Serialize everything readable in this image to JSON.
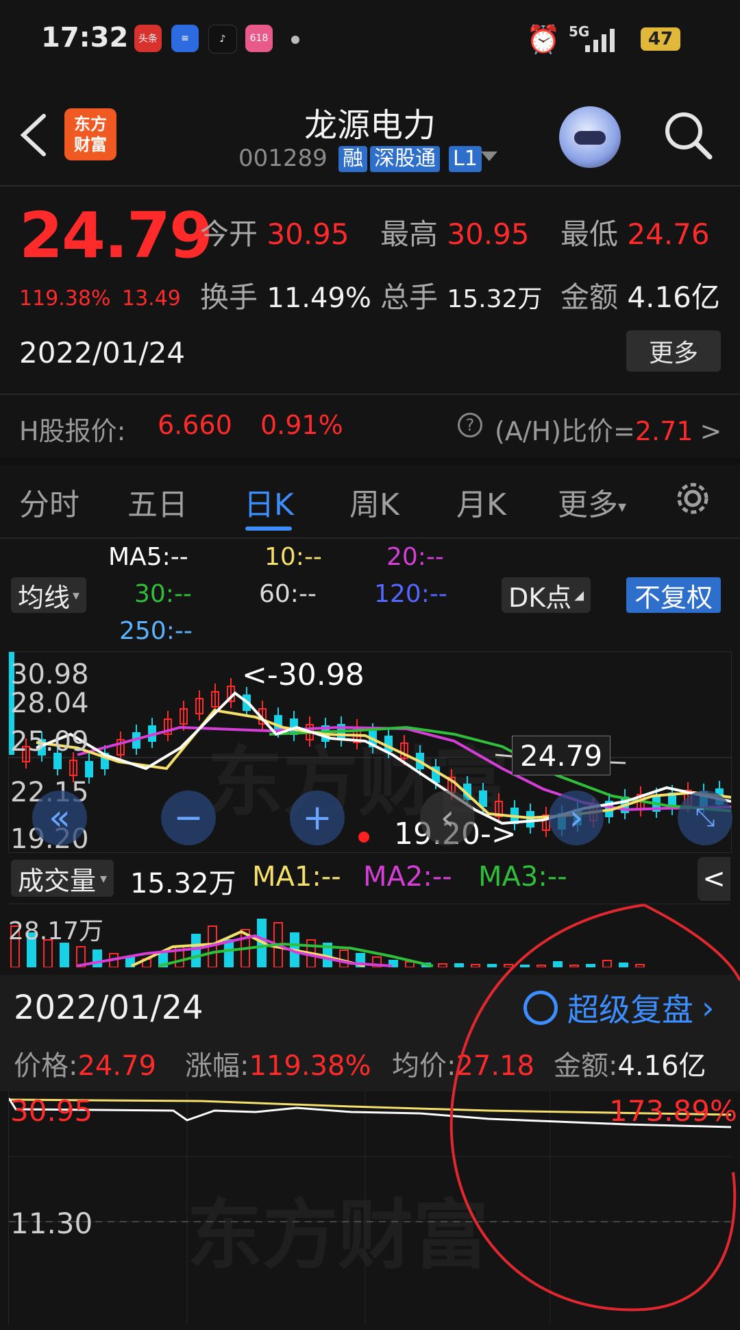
{
  "status_bar": {
    "time": "17:32",
    "battery": "47",
    "signal": "5G"
  },
  "header": {
    "logo_text": "东方财富",
    "title": "龙源电力",
    "code": "001289",
    "tags": [
      "融",
      "深股通",
      "L1"
    ]
  },
  "quote": {
    "price": "24.79",
    "change_pct": "119.38%",
    "change": "13.49",
    "date": "2022/01/24",
    "open_label": "今开",
    "open": "30.95",
    "high_label": "最高",
    "high": "30.95",
    "low_label": "最低",
    "low": "24.76",
    "turnover_label": "换手",
    "turnover": "11.49%",
    "volume_label": "总手",
    "volume": "15.32万",
    "amount_label": "金额",
    "amount": "4.16亿",
    "more_button": "更多"
  },
  "hshare": {
    "label": "H股报价:",
    "price": "6.660",
    "pct": "0.91%",
    "ratio_label": "(A/H)比价=",
    "ratio": "2.71",
    "arrow": ">"
  },
  "tabs": [
    "分时",
    "五日",
    "日K",
    "周K",
    "月K",
    "更多"
  ],
  "active_tab": "日K",
  "ma_legend": {
    "ma5": "MA5:--",
    "ma10": "10:--",
    "ma20": "20:--",
    "ma30": "30:--",
    "ma60": "60:--",
    "ma120": "120:--",
    "ma250": "250:--",
    "dropdown": "均线",
    "dk": "DK点",
    "adjust": "不复权"
  },
  "kchart": {
    "y_labels": [
      "30.98",
      "28.04",
      "25.09",
      "22.15",
      "19.20"
    ],
    "max_annotation": "<-30.98",
    "min_annotation": "19.20->",
    "last_price": "24.79",
    "watermark": "东方财富",
    "colors": {
      "up": "#ff2a2a",
      "down": "#17d2e6",
      "ma5": "#ffffff",
      "ma10": "#f4e06a",
      "ma20": "#d63ed8",
      "ma30": "#2fbf3b",
      "ma60": "#cfcfcf"
    }
  },
  "volume": {
    "dropdown": "成交量",
    "value": "15.32万",
    "ma1": "MA1:--",
    "ma2": "MA2:--",
    "ma3": "MA3:--",
    "y_label": "28.17万",
    "collapse": "<"
  },
  "detail": {
    "date": "2022/01/24",
    "super_review": "超级复盘",
    "price_label": "价格:",
    "price": "24.79",
    "pct_label": "涨幅:",
    "pct": "119.38%",
    "avg_label": "均价:",
    "avg": "27.18",
    "amount_label": "金额:",
    "amount": "4.16亿"
  },
  "intraday": {
    "top_label": "30.95",
    "top_pct": "173.89%",
    "mid_label": "11.30",
    "watermark": "东方财富"
  }
}
